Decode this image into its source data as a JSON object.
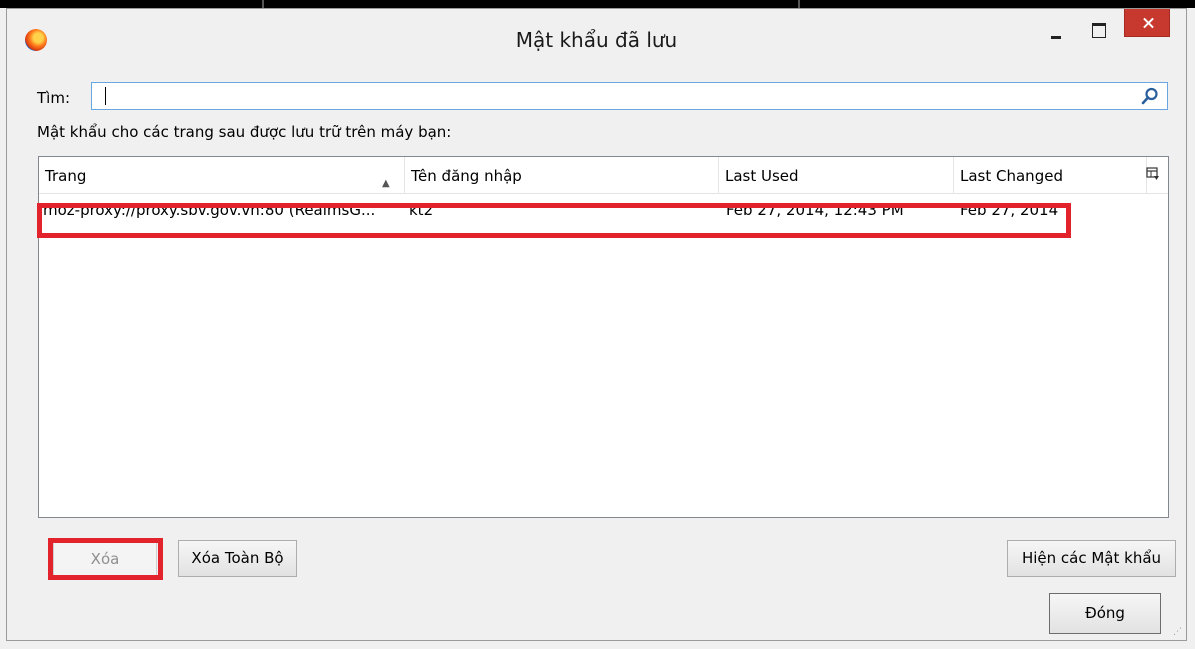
{
  "window": {
    "title": "Mật khẩu đã lưu"
  },
  "search": {
    "label": "Tìm:",
    "value": "",
    "placeholder": ""
  },
  "description": "Mật khẩu cho các trang sau được lưu trữ trên máy bạn:",
  "table": {
    "columns": [
      "Trang",
      "Tên đăng nhập",
      "Last Used",
      "Last Changed"
    ],
    "sorted_column": "Trang",
    "rows": [
      {
        "site": "moz-proxy://proxy.sbv.gov.vn:80 (RealmsG...",
        "username": "kt2",
        "last_used": "Feb 27, 2014, 12:43 PM",
        "last_changed": "Feb 27, 2014"
      }
    ]
  },
  "buttons": {
    "delete": "Xóa",
    "delete_all": "Xóa Toàn Bộ",
    "show_passwords": "Hiện các Mật khẩu",
    "close": "Đóng"
  },
  "icons": {
    "app": "firefox-icon",
    "search": "search-icon",
    "sort": "sort-ascending-icon",
    "column_picker": "column-picker-icon"
  },
  "colors": {
    "highlight": "#e3232c",
    "close_button": "#c7392f",
    "search_border": "#6aa7e0"
  }
}
